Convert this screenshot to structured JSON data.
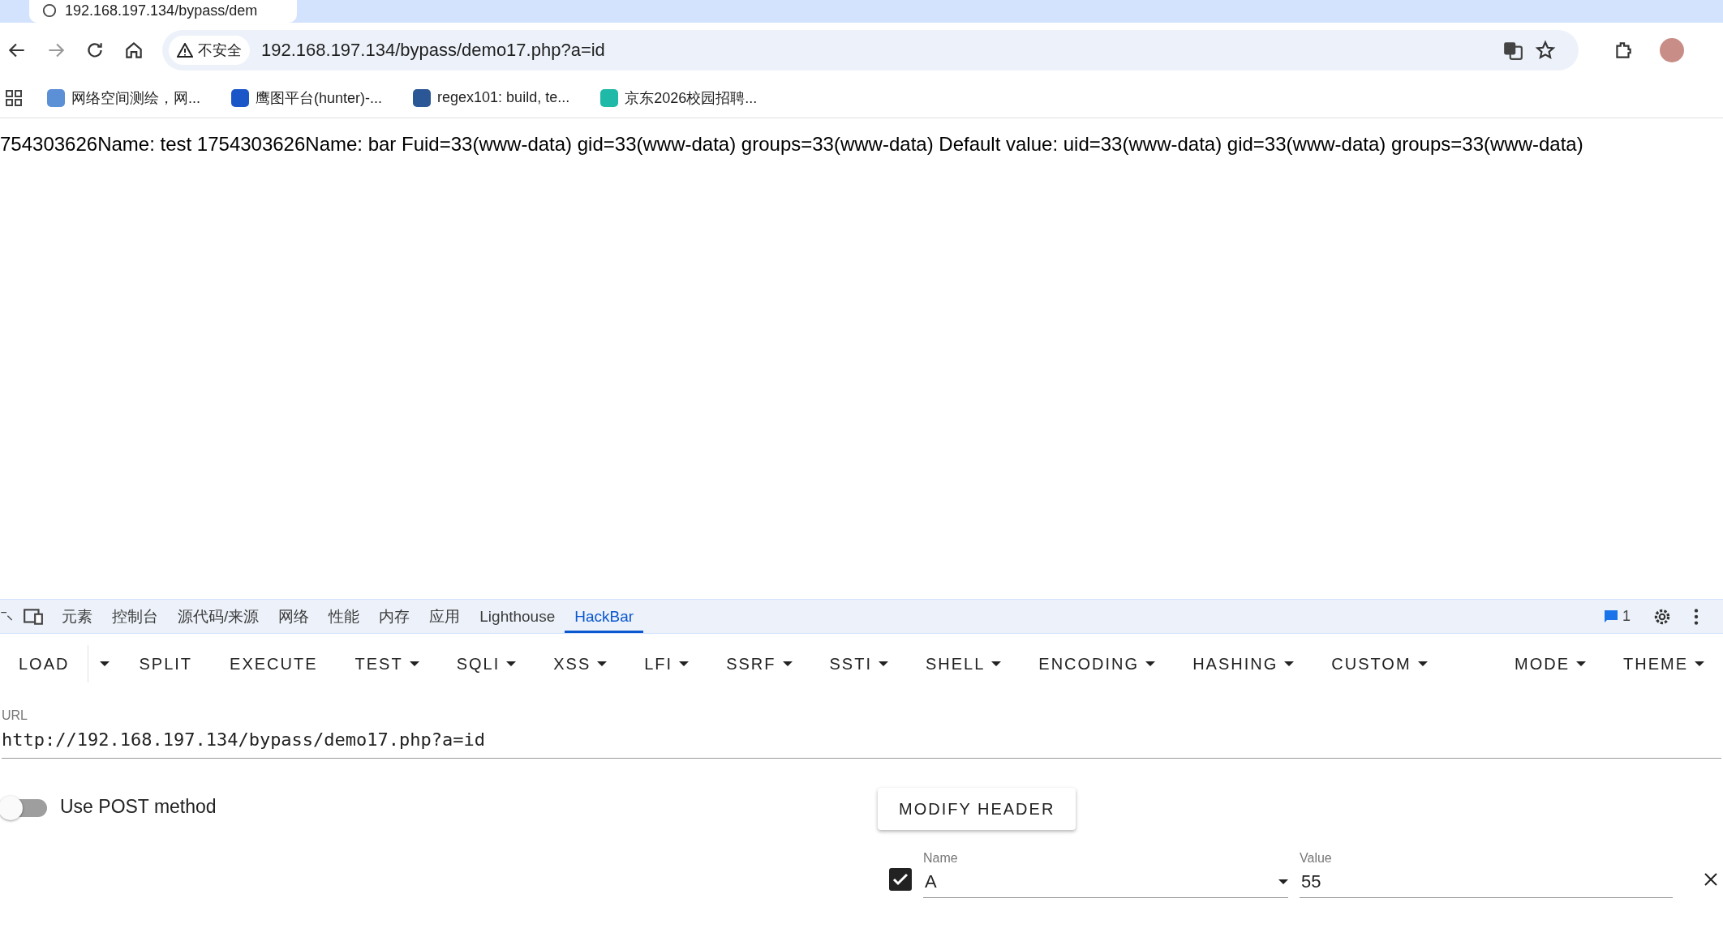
{
  "browser": {
    "tab": {
      "title": "192.168.197.134/bypass/dem"
    },
    "security_label": "不安全",
    "address": "192.168.197.134/bypass/demo17.php?a=id",
    "bookmarks": [
      {
        "label": "网络空间测绘，网...",
        "color": "#5b8fd6"
      },
      {
        "label": "鹰图平台(hunter)-...",
        "color": "#1a56c8"
      },
      {
        "label": "regex101: build, te...",
        "color": "#2b5797"
      },
      {
        "label": "京东2026校园招聘...",
        "color": "#1fb9a8"
      }
    ]
  },
  "page": {
    "text": "754303626Name: test 1754303626Name: bar Fuid=33(www-data) gid=33(www-data) groups=33(www-data) Default value: uid=33(www-data) gid=33(www-data) groups=33(www-data)"
  },
  "devtools": {
    "tabs": [
      {
        "label": "元素",
        "selected": false
      },
      {
        "label": "控制台",
        "selected": false
      },
      {
        "label": "源代码/来源",
        "selected": false
      },
      {
        "label": "网络",
        "selected": false
      },
      {
        "label": "性能",
        "selected": false
      },
      {
        "label": "内存",
        "selected": false
      },
      {
        "label": "应用",
        "selected": false
      },
      {
        "label": "Lighthouse",
        "selected": false
      },
      {
        "label": "HackBar",
        "selected": true
      }
    ],
    "issues_count": "1"
  },
  "hackbar": {
    "menu": [
      {
        "label": "LOAD",
        "kind": "split"
      },
      {
        "label": "SPLIT",
        "kind": "plain"
      },
      {
        "label": "EXECUTE",
        "kind": "plain"
      },
      {
        "label": "TEST",
        "kind": "menu"
      },
      {
        "label": "SQLI",
        "kind": "menu"
      },
      {
        "label": "XSS",
        "kind": "menu"
      },
      {
        "label": "LFI",
        "kind": "menu"
      },
      {
        "label": "SSRF",
        "kind": "menu"
      },
      {
        "label": "SSTI",
        "kind": "menu"
      },
      {
        "label": "SHELL",
        "kind": "menu"
      },
      {
        "label": "ENCODING",
        "kind": "menu"
      },
      {
        "label": "HASHING",
        "kind": "menu"
      },
      {
        "label": "CUSTOM",
        "kind": "menu"
      }
    ],
    "menu_right": [
      {
        "label": "MODE",
        "kind": "menu"
      },
      {
        "label": "THEME",
        "kind": "menu"
      }
    ],
    "url_label": "URL",
    "url": "http://192.168.197.134/bypass/demo17.php?a=id",
    "post": {
      "label": "Use POST method",
      "on": false
    },
    "modify_header": "MODIFY HEADER",
    "headers": [
      {
        "checked": true,
        "name_label": "Name",
        "name": "A",
        "value_label": "Value",
        "value": "55"
      }
    ]
  }
}
